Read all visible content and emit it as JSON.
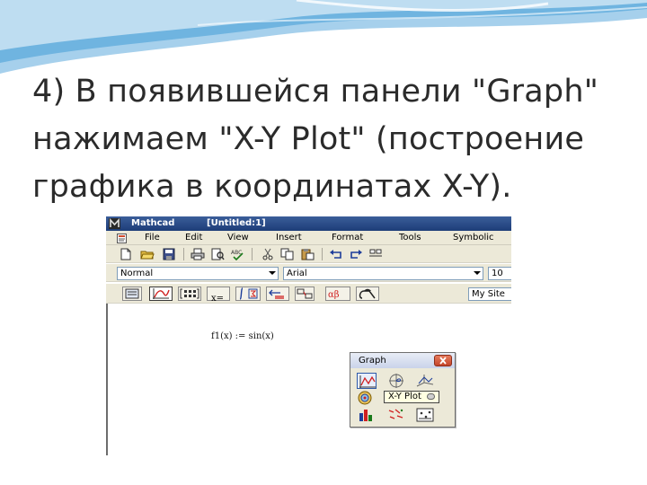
{
  "slide": {
    "title_lines": [
      "4) В появившейся панели \"Graph\"",
      "нажимаем \"X-Y Plot\" (построение",
      "графика в координатах X-Y)."
    ],
    "accent_color": "#5aa5d6"
  },
  "window": {
    "app_name": "Mathcad",
    "document": "[Untitled:1]",
    "titlebar_color": "#1d3d78"
  },
  "menu": {
    "items": [
      "File",
      "Edit",
      "View",
      "Insert",
      "Format",
      "Tools",
      "Symbolic"
    ]
  },
  "toolbars": {
    "standard_icons": [
      "new-doc-icon",
      "open-icon",
      "save-icon",
      "print-icon",
      "print-preview-icon",
      "spellcheck-icon",
      "cut-icon",
      "copy-icon",
      "paste-icon",
      "undo-icon",
      "redo-icon"
    ],
    "formatting": {
      "style_value": "Normal",
      "font_value": "Arial",
      "size_value": "10"
    },
    "math": {
      "icons": [
        "calculator-icon",
        "graph-toolbar-icon",
        "matrix-icon",
        "evaluation-icon",
        "calculus-icon",
        "boolean-icon",
        "programming-icon",
        "greek-icon",
        "symbolic-icon"
      ],
      "evaluation_label": "x=",
      "resources_value": "My Site"
    }
  },
  "worksheet": {
    "formula": "f1(x) := sin(x)"
  },
  "graph_palette": {
    "title": "Graph",
    "buttons": [
      "xy-plot-icon",
      "polar-plot-icon",
      "surface-plot-icon",
      "contour-plot-icon",
      "3d-scatter-icon",
      "3d-bar-icon",
      "vector-field-icon",
      "trace-icon",
      "zoom-icon"
    ],
    "tooltip": "X-Y Plot"
  }
}
